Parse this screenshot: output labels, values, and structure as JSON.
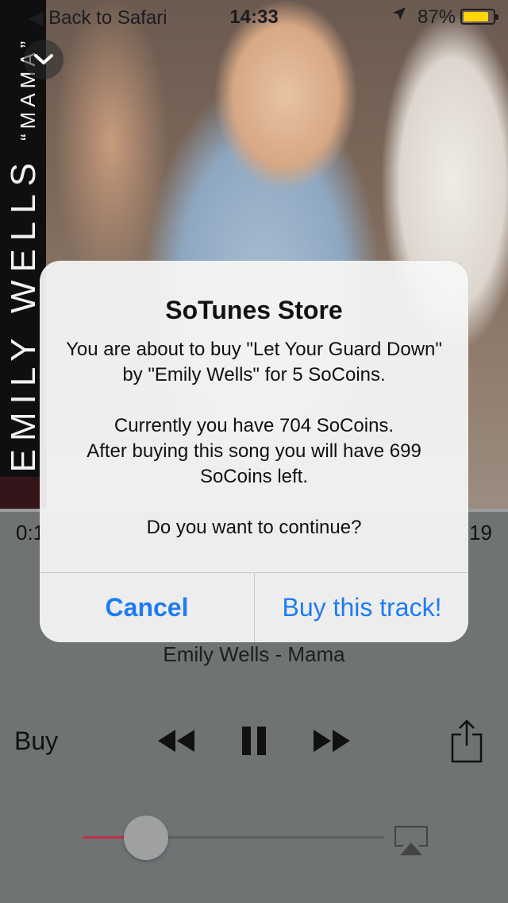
{
  "status_bar": {
    "back_label": "◀ Back to Safari",
    "time": "14:33",
    "battery_percent": "87%",
    "battery_level": 0.87,
    "battery_color": "#ffd60a",
    "location_icon": "location-arrow-icon"
  },
  "album_art": {
    "artist_text": "EMILY WELLS",
    "album_text": "“MAMA”"
  },
  "player": {
    "elapsed": "0:1",
    "remaining": "19",
    "subtitle": "Emily Wells - Mama",
    "buy_label": "Buy",
    "volume_level": 0.21,
    "accent_color": "#c0304a",
    "icons": [
      "chevron-down-icon",
      "rewind-icon",
      "pause-icon",
      "fast-forward-icon",
      "share-icon",
      "airplay-icon"
    ]
  },
  "alert": {
    "title": "SoTunes Store",
    "message": "You are about to buy \"Let Your Guard Down\" by \"Emily Wells\" for 5 SoCoins.\n\nCurrently you have 704 SoCoins.\nAfter buying this song you will have 699 SoCoins left.\n\nDo you want to continue?",
    "cancel_label": "Cancel",
    "confirm_label": "Buy this track!",
    "button_color": "#1e7cf2"
  }
}
